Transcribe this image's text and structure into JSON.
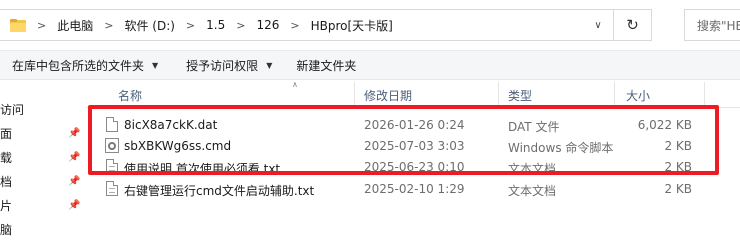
{
  "address": {
    "crumbs": [
      "此电脑",
      "软件 (D:)",
      "1.5",
      "126",
      "HBpro[天卡版]"
    ],
    "search_placeholder": "搜索\"HB"
  },
  "toolbar": {
    "include_library": "在库中包含所选的文件夹",
    "grant_access": "授予访问权限",
    "new_folder": "新建文件夹"
  },
  "nav": {
    "items": [
      "访问",
      "面",
      "载",
      "档",
      "片",
      "脑"
    ]
  },
  "columns": {
    "name": "名称",
    "modified": "修改日期",
    "type": "类型",
    "size": "大小"
  },
  "files": [
    {
      "name": "8icX8a7ckK.dat",
      "modified": "2026-01-26 0:24",
      "type": "DAT 文件",
      "size": "6,022 KB",
      "icon": "file-icon"
    },
    {
      "name": "sbXBKWg6ss.cmd",
      "modified": "2025-07-03 3:03",
      "type": "Windows 命令脚本",
      "size": "2 KB",
      "icon": "cmd-script-icon"
    },
    {
      "name": "使用说明,首次使用必须看.txt",
      "modified": "2025-06-23 0:10",
      "type": "文本文档",
      "size": "2 KB",
      "icon": "text-file-icon"
    },
    {
      "name": "右键管理运行cmd文件启动辅助.txt",
      "modified": "2025-02-10 1:29",
      "type": "文本文档",
      "size": "2 KB",
      "icon": "text-file-icon"
    }
  ],
  "colors": {
    "highlight": "#ee1b24",
    "header_text": "#4c607a"
  }
}
